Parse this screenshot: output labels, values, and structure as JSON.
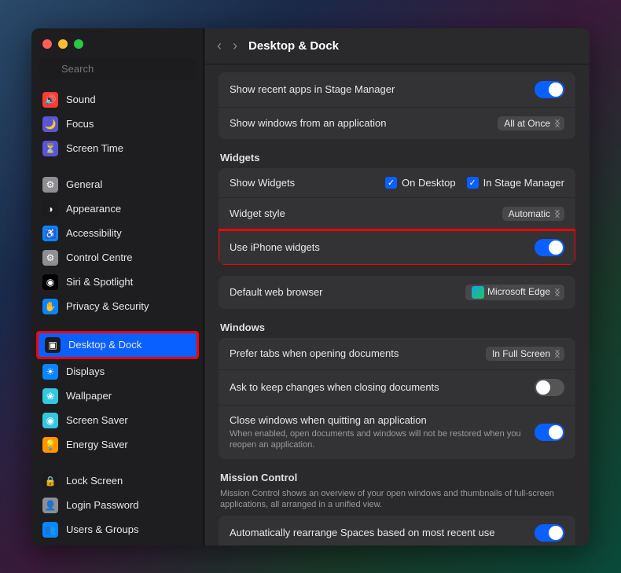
{
  "header": {
    "title": "Desktop & Dock"
  },
  "search": {
    "placeholder": "Search"
  },
  "sidebar": {
    "items": [
      {
        "label": "Sound",
        "icon": "🔊",
        "bg": "#ff3b30"
      },
      {
        "label": "Focus",
        "icon": "🌙",
        "bg": "#5856d6"
      },
      {
        "label": "Screen Time",
        "icon": "⏳",
        "bg": "#5856d6"
      },
      {
        "sep": true
      },
      {
        "label": "General",
        "icon": "⚙",
        "bg": "#8e8e93"
      },
      {
        "label": "Appearance",
        "icon": "◑",
        "bg": "#1c1c1e"
      },
      {
        "label": "Accessibility",
        "icon": "♿",
        "bg": "#0a84ff"
      },
      {
        "label": "Control Centre",
        "icon": "⚙",
        "bg": "#8e8e93"
      },
      {
        "label": "Siri & Spotlight",
        "icon": "◉",
        "bg": "#000"
      },
      {
        "label": "Privacy & Security",
        "icon": "✋",
        "bg": "#0a84ff"
      },
      {
        "sep": true
      },
      {
        "label": "Desktop & Dock",
        "icon": "▣",
        "bg": "#1c1c1e",
        "selected": true,
        "highlight": true
      },
      {
        "label": "Displays",
        "icon": "☀",
        "bg": "#0a84ff"
      },
      {
        "label": "Wallpaper",
        "icon": "❀",
        "bg": "#34c7e0"
      },
      {
        "label": "Screen Saver",
        "icon": "◉",
        "bg": "#34c7e0"
      },
      {
        "label": "Energy Saver",
        "icon": "💡",
        "bg": "#ff9500"
      },
      {
        "sep": true
      },
      {
        "label": "Lock Screen",
        "icon": "🔒",
        "bg": "#1c1c1e"
      },
      {
        "label": "Login Password",
        "icon": "👤",
        "bg": "#8e8e93"
      },
      {
        "label": "Users & Groups",
        "icon": "👥",
        "bg": "#0a84ff"
      }
    ]
  },
  "stage_manager": {
    "recent_apps_label": "Show recent apps in Stage Manager",
    "recent_apps_on": true,
    "windows_from_app_label": "Show windows from an application",
    "windows_from_app_value": "All at Once"
  },
  "widgets": {
    "title": "Widgets",
    "show_widgets_label": "Show Widgets",
    "on_desktop_label": "On Desktop",
    "in_stage_manager_label": "In Stage Manager",
    "style_label": "Widget style",
    "style_value": "Automatic",
    "iphone_label": "Use iPhone widgets",
    "iphone_on": true
  },
  "browser": {
    "label": "Default web browser",
    "value": "Microsoft Edge"
  },
  "windows": {
    "title": "Windows",
    "prefer_tabs_label": "Prefer tabs when opening documents",
    "prefer_tabs_value": "In Full Screen",
    "ask_keep_label": "Ask to keep changes when closing documents",
    "ask_keep_on": false,
    "close_quit_label": "Close windows when quitting an application",
    "close_quit_sub": "When enabled, open documents and windows will not be restored when you reopen an application.",
    "close_quit_on": true
  },
  "mission": {
    "title": "Mission Control",
    "sub": "Mission Control shows an overview of your open windows and thumbnails of full-screen applications, all arranged in a unified view.",
    "auto_rearrange_label": "Automatically rearrange Spaces based on most recent use",
    "auto_rearrange_on": true
  }
}
